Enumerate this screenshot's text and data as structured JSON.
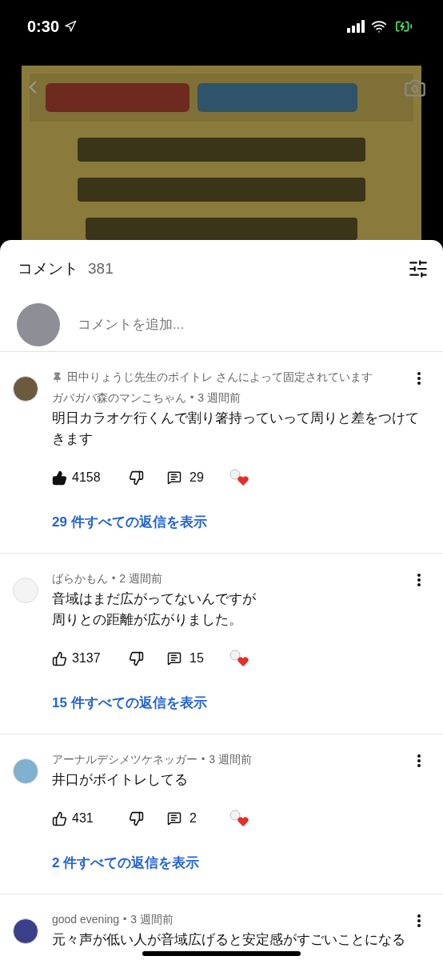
{
  "status_bar": {
    "time": "0:30"
  },
  "comments_panel": {
    "title": "コメント",
    "count": "381",
    "add_comment": {
      "placeholder": "コメントを追加..."
    },
    "comments": [
      {
        "pinned_note": "田中りょうじ先生のボイトレ さんによって固定されています",
        "author": "ガバガバ森のマンこちゃん",
        "time": "3 週間前",
        "text_lines": [
          "明日カラオケ行くんで割り箸持っていって周りと差をつけてきます"
        ],
        "separator": "•",
        "likes": "4158",
        "liked": true,
        "replies": "29",
        "hearted": true,
        "view_replies": "29 件すべての返信を表示"
      },
      {
        "author": "ばらかもん",
        "time": "2 週間前",
        "text_lines": [
          "音域はまだ広がってないんですが",
          "周りとの距離が広がりました。"
        ],
        "separator": "•",
        "likes": "3137",
        "liked": false,
        "replies": "15",
        "hearted": true,
        "view_replies": "15 件すべての返信を表示"
      },
      {
        "author": "アーナルデシメツケネッガー",
        "time": "3 週間前",
        "text_lines": [
          "井口がボイトレしてる"
        ],
        "separator": "•",
        "likes": "431",
        "liked": false,
        "replies": "2",
        "hearted": true,
        "view_replies": "2 件すべての返信を表示"
      },
      {
        "author": "good evening",
        "time": "3 週間前",
        "text_lines": [
          "元々声が低い人が音域広げると安定感がすごいことになる"
        ],
        "separator": "•"
      }
    ]
  }
}
